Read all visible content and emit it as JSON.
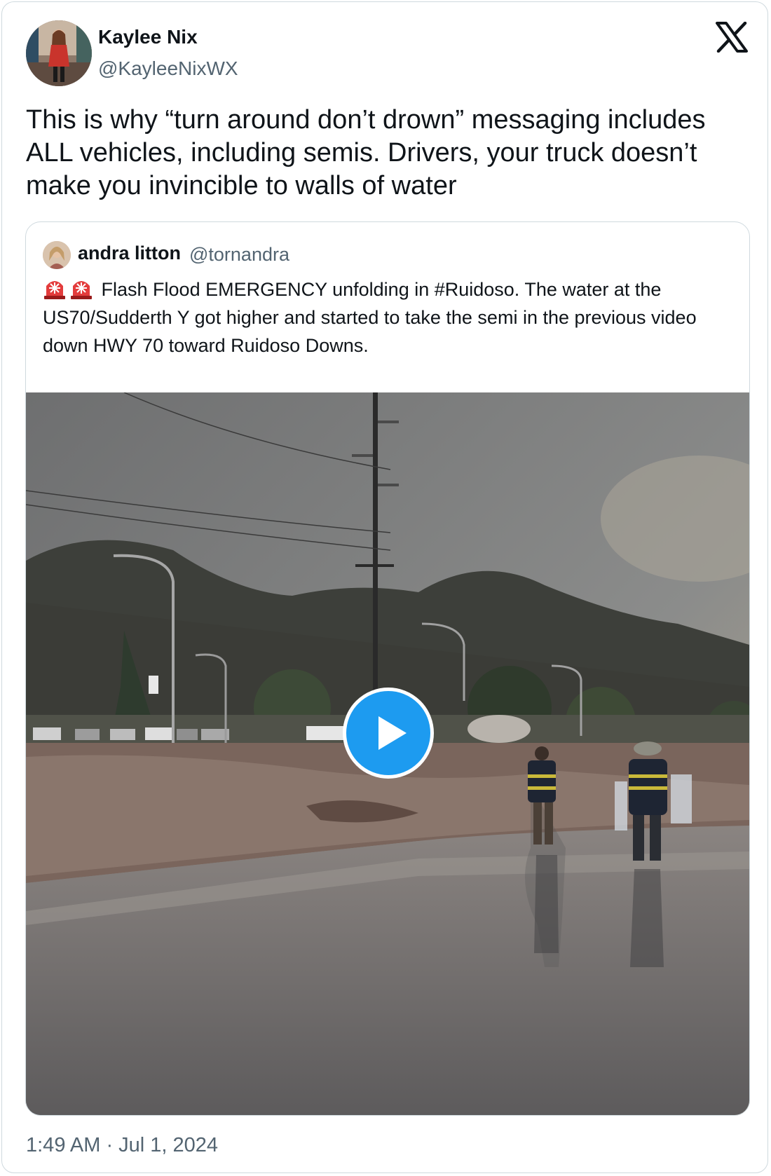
{
  "author": {
    "name": "Kaylee Nix",
    "handle": "@KayleeNixWX",
    "avatar": "profile-photo"
  },
  "brand": {
    "logo": "x-logo-icon"
  },
  "tweet": {
    "text": "This is why “turn around don’t drown” messaging includes ALL vehicles, including semis. Drivers, your truck doesn’t make you invincible to walls of water"
  },
  "quoted_tweet": {
    "author_name": "andra litton",
    "author_handle": "@tornandra",
    "emoji": "siren-icon",
    "text": "Flash Flood EMERGENCY unfolding in #Ruidoso. The water at the US70/Sudderth Y got higher and started to take the semi in the previous video down HWY 70 toward Ruidoso Downs.",
    "media": {
      "type": "video",
      "description": "flooded roadway with mountains and two workers",
      "play_icon": "play-icon"
    }
  },
  "meta": {
    "timestamp": "1:49 AM · Jul 1, 2024"
  },
  "colors": {
    "text_primary": "#0f1419",
    "text_secondary": "#536471",
    "border": "#cfd9de",
    "accent": "#1d9bf0"
  }
}
